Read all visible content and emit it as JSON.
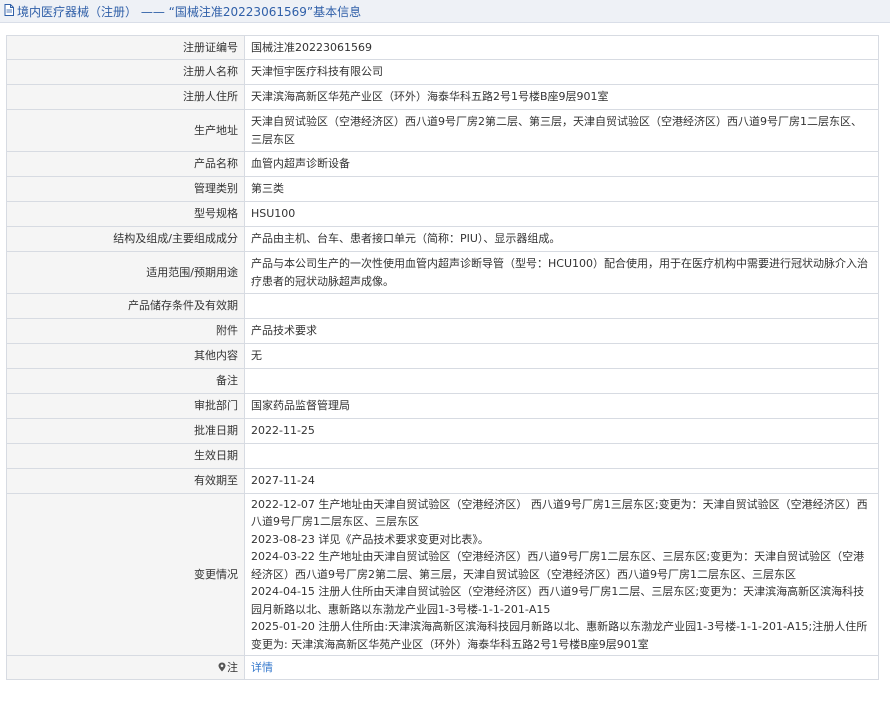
{
  "header": {
    "prefix": "境内医疗器械（注册）",
    "separator": "——",
    "title": "“国械注准20223061569”基本信息"
  },
  "rows": {
    "reg_no": {
      "label": "注册证编号",
      "value": "国械注准20223061569"
    },
    "registrant": {
      "label": "注册人名称",
      "value": "天津恒宇医疗科技有限公司"
    },
    "registrant_addr": {
      "label": "注册人住所",
      "value": "天津滨海高新区华苑产业区（环外）海泰华科五路2号1号楼B座9层901室"
    },
    "production_addr": {
      "label": "生产地址",
      "value": "天津自贸试验区（空港经济区）西八道9号厂房2第二层、第三层，天津自贸试验区（空港经济区）西八道9号厂房1二层东区、三层东区"
    },
    "product_name": {
      "label": "产品名称",
      "value": "血管内超声诊断设备"
    },
    "category": {
      "label": "管理类别",
      "value": "第三类"
    },
    "model": {
      "label": "型号规格",
      "value": "HSU100"
    },
    "structure": {
      "label": "结构及组成/主要组成成分",
      "value": "产品由主机、台车、患者接口单元（简称：PIU）、显示器组成。"
    },
    "scope": {
      "label": "适用范围/预期用途",
      "value": "产品与本公司生产的一次性使用血管内超声诊断导管（型号：HCU100）配合使用，用于在医疗机构中需要进行冠状动脉介入治疗患者的冠状动脉超声成像。"
    },
    "storage": {
      "label": "产品储存条件及有效期",
      "value": ""
    },
    "attachment": {
      "label": "附件",
      "value": "产品技术要求"
    },
    "other": {
      "label": "其他内容",
      "value": "无"
    },
    "remark": {
      "label": "备注",
      "value": ""
    },
    "approval_dept": {
      "label": "审批部门",
      "value": "国家药品监督管理局"
    },
    "approval_date": {
      "label": "批准日期",
      "value": "2022-11-25"
    },
    "effective_date": {
      "label": "生效日期",
      "value": ""
    },
    "expiry": {
      "label": "有效期至",
      "value": "2027-11-24"
    },
    "changes": {
      "label": "变更情况",
      "entries": [
        "2022-12-07 生产地址由天津自贸试验区（空港经济区） 西八道9号厂房1三层东区;变更为：天津自贸试验区（空港经济区）西八道9号厂房1二层东区、三层东区",
        "2023-08-23 详见《产品技术要求变更对比表》。",
        "2024-03-22 生产地址由天津自贸试验区（空港经济区）西八道9号厂房1二层东区、三层东区;变更为：天津自贸试验区（空港经济区）西八道9号厂房2第二层、第三层，天津自贸试验区（空港经济区）西八道9号厂房1二层东区、三层东区",
        "2024-04-15 注册人住所由天津自贸试验区（空港经济区）西八道9号厂房1二层、三层东区;变更为：天津滨海高新区滨海科技园月新路以北、惠新路以东渤龙产业园1-3号楼-1-1-201-A15",
        "2025-01-20 注册人住所由:天津滨海高新区滨海科技园月新路以北、惠新路以东渤龙产业园1-3号楼-1-1-201-A15;注册人住所变更为: 天津滨海高新区华苑产业区（环外）海泰华科五路2号1号楼B座9层901室"
      ]
    },
    "note": {
      "label": "注",
      "link": "详情",
      "icon": "map-pin-icon"
    }
  },
  "colors": {
    "title": "#2f5fa8",
    "label_bg": "#f5f5f5",
    "border": "#d7dbe2",
    "link": "#3377cc"
  }
}
